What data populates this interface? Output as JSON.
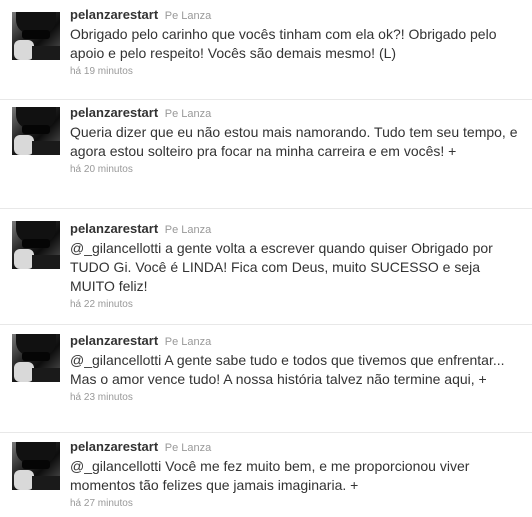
{
  "tweets": [
    {
      "screen_name": "pelanzarestart",
      "full_name": "Pe Lanza",
      "text": "Obrigado pelo carinho que vocês tinham com ela ok?! Obrigado pelo apoio e pelo respeito! Vocês são demais mesmo! (L)",
      "timestamp": "há 19 minutos"
    },
    {
      "screen_name": "pelanzarestart",
      "full_name": "Pe Lanza",
      "text": "Queria dizer que eu não estou mais namorando. Tudo tem seu tempo, e agora estou solteiro pra focar na minha carreira e em vocês! +",
      "timestamp": "há 20 minutos"
    },
    {
      "screen_name": "pelanzarestart",
      "full_name": "Pe Lanza",
      "text": "@_gilancellotti a gente volta a escrever quando quiser Obrigado por TUDO Gi. Você é LINDA! Fica com Deus, muito SUCESSO e seja MUITO feliz!",
      "timestamp": "há 22 minutos"
    },
    {
      "screen_name": "pelanzarestart",
      "full_name": "Pe Lanza",
      "text": "@_gilancellotti A gente sabe tudo e todos que tivemos que enfrentar... Mas o amor vence tudo! A nossa história talvez não termine aqui, +",
      "timestamp": "há 23 minutos"
    },
    {
      "screen_name": "pelanzarestart",
      "full_name": "Pe Lanza",
      "text": "@_gilancellotti Você me fez muito bem, e me proporcionou viver momentos tão felizes que jamais imaginaria. +",
      "timestamp": "há 27 minutos"
    }
  ]
}
